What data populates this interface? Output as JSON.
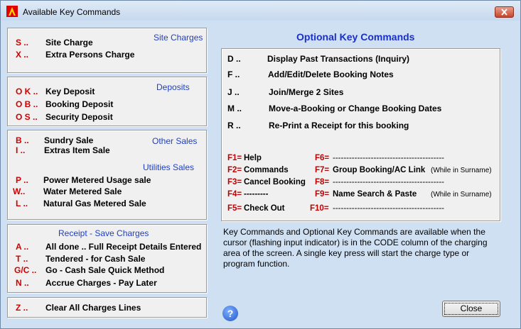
{
  "window": {
    "title": "Available Key Commands"
  },
  "site": {
    "title": "Site Charges",
    "items": [
      {
        "key": "S ..",
        "label": "Site Charge"
      },
      {
        "key": "X ..",
        "label": "Extra Persons Charge"
      }
    ]
  },
  "deposits": {
    "title": "Deposits",
    "items": [
      {
        "key": "O K ..",
        "label": "Key Deposit"
      },
      {
        "key": "O B ..",
        "label": "Booking Deposit"
      },
      {
        "key": "O S ..",
        "label": "Security Deposit"
      }
    ]
  },
  "other": {
    "title": "Other Sales",
    "utilities_title": "Utilities Sales",
    "items": [
      {
        "key": "B ..",
        "label": "Sundry Sale"
      },
      {
        "key": "I ..",
        "label": "Extras Item Sale"
      },
      {
        "key": "P ..",
        "label": "Power Metered Usage sale"
      },
      {
        "key": "W..",
        "label": "Water Metered Sale"
      },
      {
        "key": "L ..",
        "label": "Natural Gas Metered Sale"
      }
    ]
  },
  "receipt": {
    "title": "Receipt - Save Charges",
    "items": [
      {
        "key": "A ..",
        "label": "All done .. Full Receipt Details Entered"
      },
      {
        "key": "T ..",
        "label": "Tendered - for Cash Sale"
      },
      {
        "key": "G/C ..",
        "label": "Go - Cash Sale Quick Method"
      },
      {
        "key": "N ..",
        "label": "Accrue Charges - Pay Later"
      }
    ]
  },
  "clear": {
    "key": "Z ..",
    "label": "Clear All Charges Lines"
  },
  "optional": {
    "heading": "Optional Key Commands",
    "items": [
      {
        "key": "D ..",
        "label": "Display Past Transactions (Inquiry)"
      },
      {
        "key": "F ..",
        "label": "Add/Edit/Delete Booking Notes"
      },
      {
        "key": "J ..",
        "label": "Join/Merge 2 Sites"
      },
      {
        "key": "M ..",
        "label": "Move-a-Booking or Change Booking Dates"
      },
      {
        "key": "R ..",
        "label": "Re-Print a Receipt for this booking"
      }
    ]
  },
  "fkeys": {
    "left": [
      {
        "key": "F1=",
        "label": "Help"
      },
      {
        "key": "F2=",
        "label": "Commands"
      },
      {
        "key": "F3=",
        "label": "Cancel Booking"
      },
      {
        "key": "F4=",
        "label": "---------"
      },
      {
        "key": "F5=",
        "label": "Check Out"
      }
    ],
    "right": [
      {
        "key": "F6=",
        "label": "-----------------------------------------",
        "note": ""
      },
      {
        "key": "F7=",
        "label": "Group Booking/AC Link",
        "note": "(While in Surname)"
      },
      {
        "key": "F8=",
        "label": "-----------------------------------------",
        "note": ""
      },
      {
        "key": "F9=",
        "label": "Name Search & Paste",
        "note": "(While in Surname)"
      },
      {
        "key": "F10=",
        "label": "-----------------------------------------",
        "note": ""
      }
    ]
  },
  "description": "Key Commands and Optional Key Commands are available when the cursor (flashing input indicator) is in the CODE column of the charging area of the screen. A single key press will start the charge type or program function.",
  "buttons": {
    "close": "Close",
    "help": "?"
  },
  "colors": {
    "key_red": "#d10000",
    "title_blue": "#1a2fc8",
    "group_title_blue": "#2040c0"
  }
}
